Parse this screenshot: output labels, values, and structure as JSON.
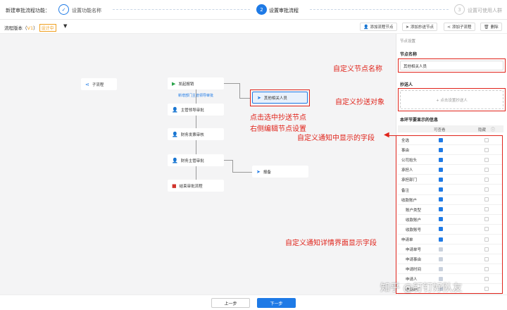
{
  "header": {
    "title": "新建审批流程功能：",
    "steps": [
      {
        "num": "✓",
        "label": "设置功能名称"
      },
      {
        "num": "2",
        "label": "设置审批流程"
      },
      {
        "num": "3",
        "label": "设置可使用人群"
      }
    ]
  },
  "toolbar": {
    "version_label": "流程版本（",
    "version": "V1",
    "version_close": "）",
    "status": "设计中",
    "buttons": [
      "添加流程节点",
      "添加抄送节点",
      "添加子流程",
      "删除"
    ]
  },
  "flow": {
    "subflow": "子流程",
    "start": "发起报销",
    "start_note": "新增部门主管领导审批",
    "cc_selected": "其他相关人员",
    "n1": "主管领导审批",
    "n2": "财务发票审核",
    "n3": "财务主管审批",
    "cc2": "报备",
    "end": "结束审批流程"
  },
  "panel": {
    "title": "节点设置",
    "name_label": "节点名称",
    "name_value": "其他相关人员",
    "cc_label": "抄送人",
    "cc_placeholder": "+ 点击设置抄送人",
    "fields_label": "本环节要显示的信息",
    "col_visible": "可查看",
    "col_hidden": "隐藏",
    "rows": [
      {
        "label": "全选",
        "indent": 0,
        "state": "on"
      },
      {
        "label": "事由",
        "indent": 0,
        "state": "on"
      },
      {
        "label": "公司抬头",
        "indent": 0,
        "state": "on"
      },
      {
        "label": "承担人",
        "indent": 0,
        "state": "on"
      },
      {
        "label": "承担部门",
        "indent": 0,
        "state": "on"
      },
      {
        "label": "备注",
        "indent": 0,
        "state": "on"
      },
      {
        "label": "收款账户",
        "indent": 0,
        "state": "on"
      },
      {
        "label": "账户类型",
        "indent": 1,
        "state": "on"
      },
      {
        "label": "收款账户",
        "indent": 1,
        "state": "on"
      },
      {
        "label": "收款账号",
        "indent": 1,
        "state": "on"
      },
      {
        "label": "申请单",
        "indent": 0,
        "state": "on"
      },
      {
        "label": "申请单号",
        "indent": 1,
        "state": "gray"
      },
      {
        "label": "申请事由",
        "indent": 1,
        "state": "gray"
      },
      {
        "label": "申请时间",
        "indent": 1,
        "state": "gray"
      },
      {
        "label": "申请人",
        "indent": 1,
        "state": "gray"
      },
      {
        "label": "申请部门",
        "indent": 1,
        "state": "gray"
      }
    ]
  },
  "annotations": {
    "a1": "自定义节点名称",
    "a2": "自定义抄送对象",
    "a3": "点击选中抄送节点",
    "a4": "右侧编辑节点设置",
    "a5": "自定义通知中显示的字段",
    "a6": "自定义通知详情界面显示字段"
  },
  "footer": {
    "prev": "上一步",
    "next": "下一步"
  },
  "watermark": "知乎 @钉钉好队友"
}
